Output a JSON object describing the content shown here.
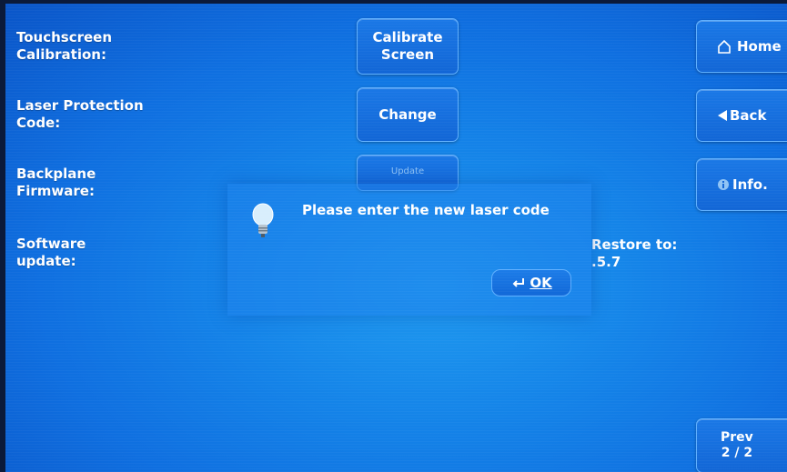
{
  "rows": [
    {
      "label": "Touchscreen\nCalibration:",
      "button": "Calibrate\nScreen"
    },
    {
      "label": "Laser Protection\nCode:",
      "button": "Change"
    },
    {
      "label": "Backplane\nFirmware:",
      "button": "Update"
    },
    {
      "label": "Software\nupdate:"
    }
  ],
  "side_nav": {
    "home": {
      "label": "Home",
      "icon": "home-icon"
    },
    "back": {
      "label": "Back",
      "icon": "back-arrow-icon"
    },
    "info": {
      "label": "Info.",
      "icon": "info-icon"
    }
  },
  "dialog": {
    "message": "Please enter the new laser code",
    "icon": "lightbulb-icon",
    "ok_label": "OK",
    "ok_icon": "enter-key-icon"
  },
  "restore_text": "Restore to:\n.5.7",
  "pager": {
    "label": "Prev\n2 / 2"
  },
  "colors": {
    "background": "#1483e8",
    "button": "#1266d6",
    "border": "#5fb0ff"
  }
}
